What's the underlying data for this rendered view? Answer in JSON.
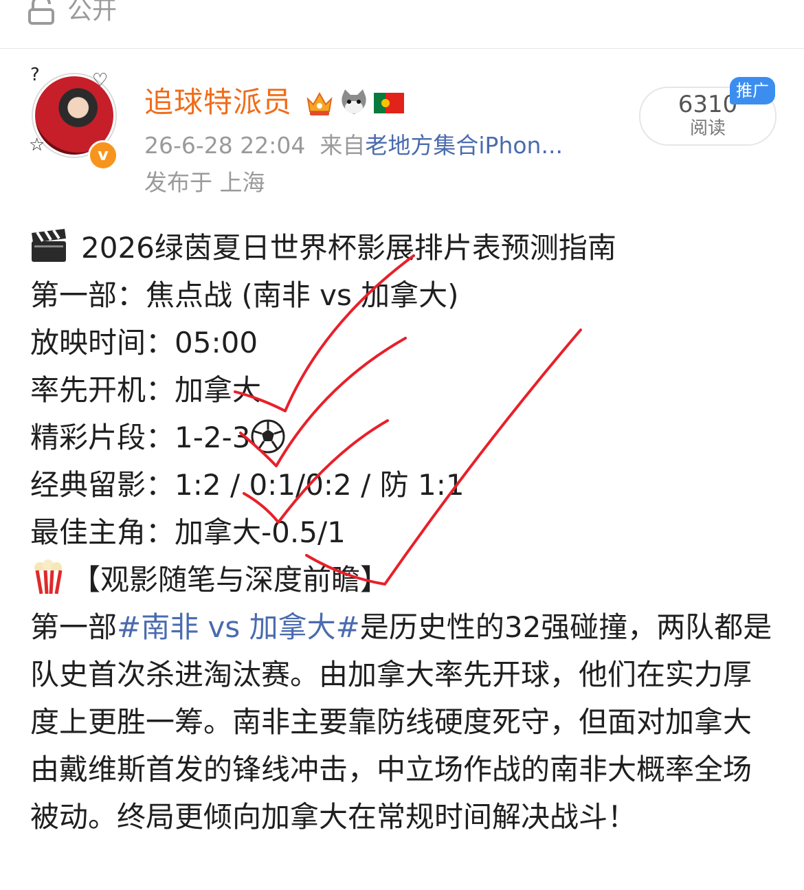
{
  "header": {
    "visibility": "公开"
  },
  "author": {
    "name": "追球特派员",
    "timestamp": "26-6-28 22:04",
    "source_prefix": "来自",
    "source": "老地方集合iPhon...",
    "location": "发布于 上海",
    "badges": [
      "crown-icon",
      "cat-icon",
      "portugal-flag-icon"
    ],
    "verified": true
  },
  "stats": {
    "read_count": "6310",
    "read_label": "阅读",
    "promo_tag": "推广"
  },
  "post": {
    "title": "2026绿茵夏日世界杯影展排片表预测指南",
    "lines": [
      "第一部：焦点战 (南非 vs 加拿大)",
      "放映时间：05:00",
      "率先开机：加拿大",
      "精彩片段：1-2-3",
      "经典留影：1:2 / 0:1/0:2 / 防 1:1",
      "最佳主角：加拿大-0.5/1"
    ],
    "section_heading": "【观影随笔与深度前瞻】",
    "body_prefix": "第一部",
    "hashtag": "#南非 vs 加拿大#",
    "body_rest": "是历史性的32强碰撞，两队都是队史首次杀进淘汰赛。由加拿大率先开球，他们在实力厚度上更胜一筹。南非主要靠防线硬度死守，但面对加拿大由戴维斯首发的锋线冲击，中立场作战的南非大概率全场被动。终局更倾向加拿大在常规时间解决战斗！"
  },
  "colors": {
    "username": "#f06c1a",
    "link": "#4a6bae",
    "muted": "#9a9a9a",
    "promo": "#3b8ef0",
    "scribble": "#e8202a"
  }
}
